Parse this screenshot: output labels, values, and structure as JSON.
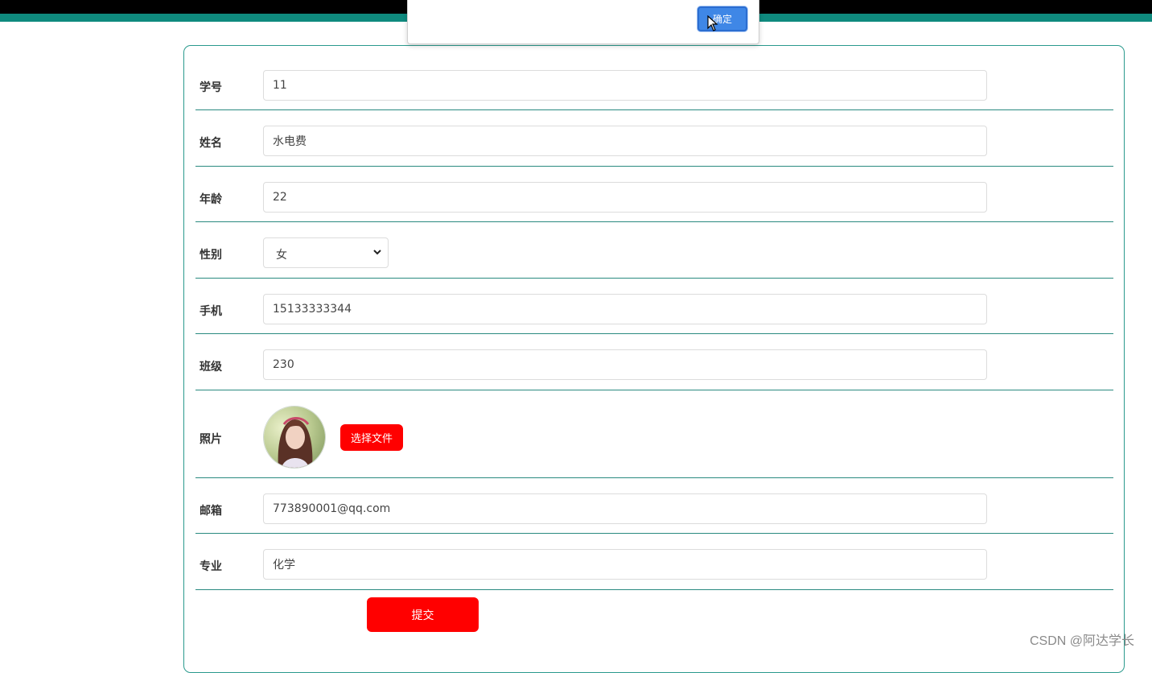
{
  "colors": {
    "accent_teal": "#0f8a7e",
    "button_red": "#ff0000",
    "ok_button_blue": "#3f87e6"
  },
  "dialog": {
    "ok_label": "确定"
  },
  "form": {
    "student_id": {
      "label": "学号",
      "value": "11"
    },
    "name": {
      "label": "姓名",
      "value": "水电费"
    },
    "age": {
      "label": "年龄",
      "value": "22"
    },
    "gender": {
      "label": "性别",
      "selected": "女"
    },
    "phone": {
      "label": "手机",
      "value": "15133333344"
    },
    "class": {
      "label": "班级",
      "value": "230"
    },
    "photo": {
      "label": "照片",
      "choose_file_label": "选择文件"
    },
    "email": {
      "label": "邮箱",
      "value": "773890001@qq.com"
    },
    "major": {
      "label": "专业",
      "value": "化学"
    },
    "submit_label": "提交"
  },
  "watermark": "CSDN @阿达学长"
}
